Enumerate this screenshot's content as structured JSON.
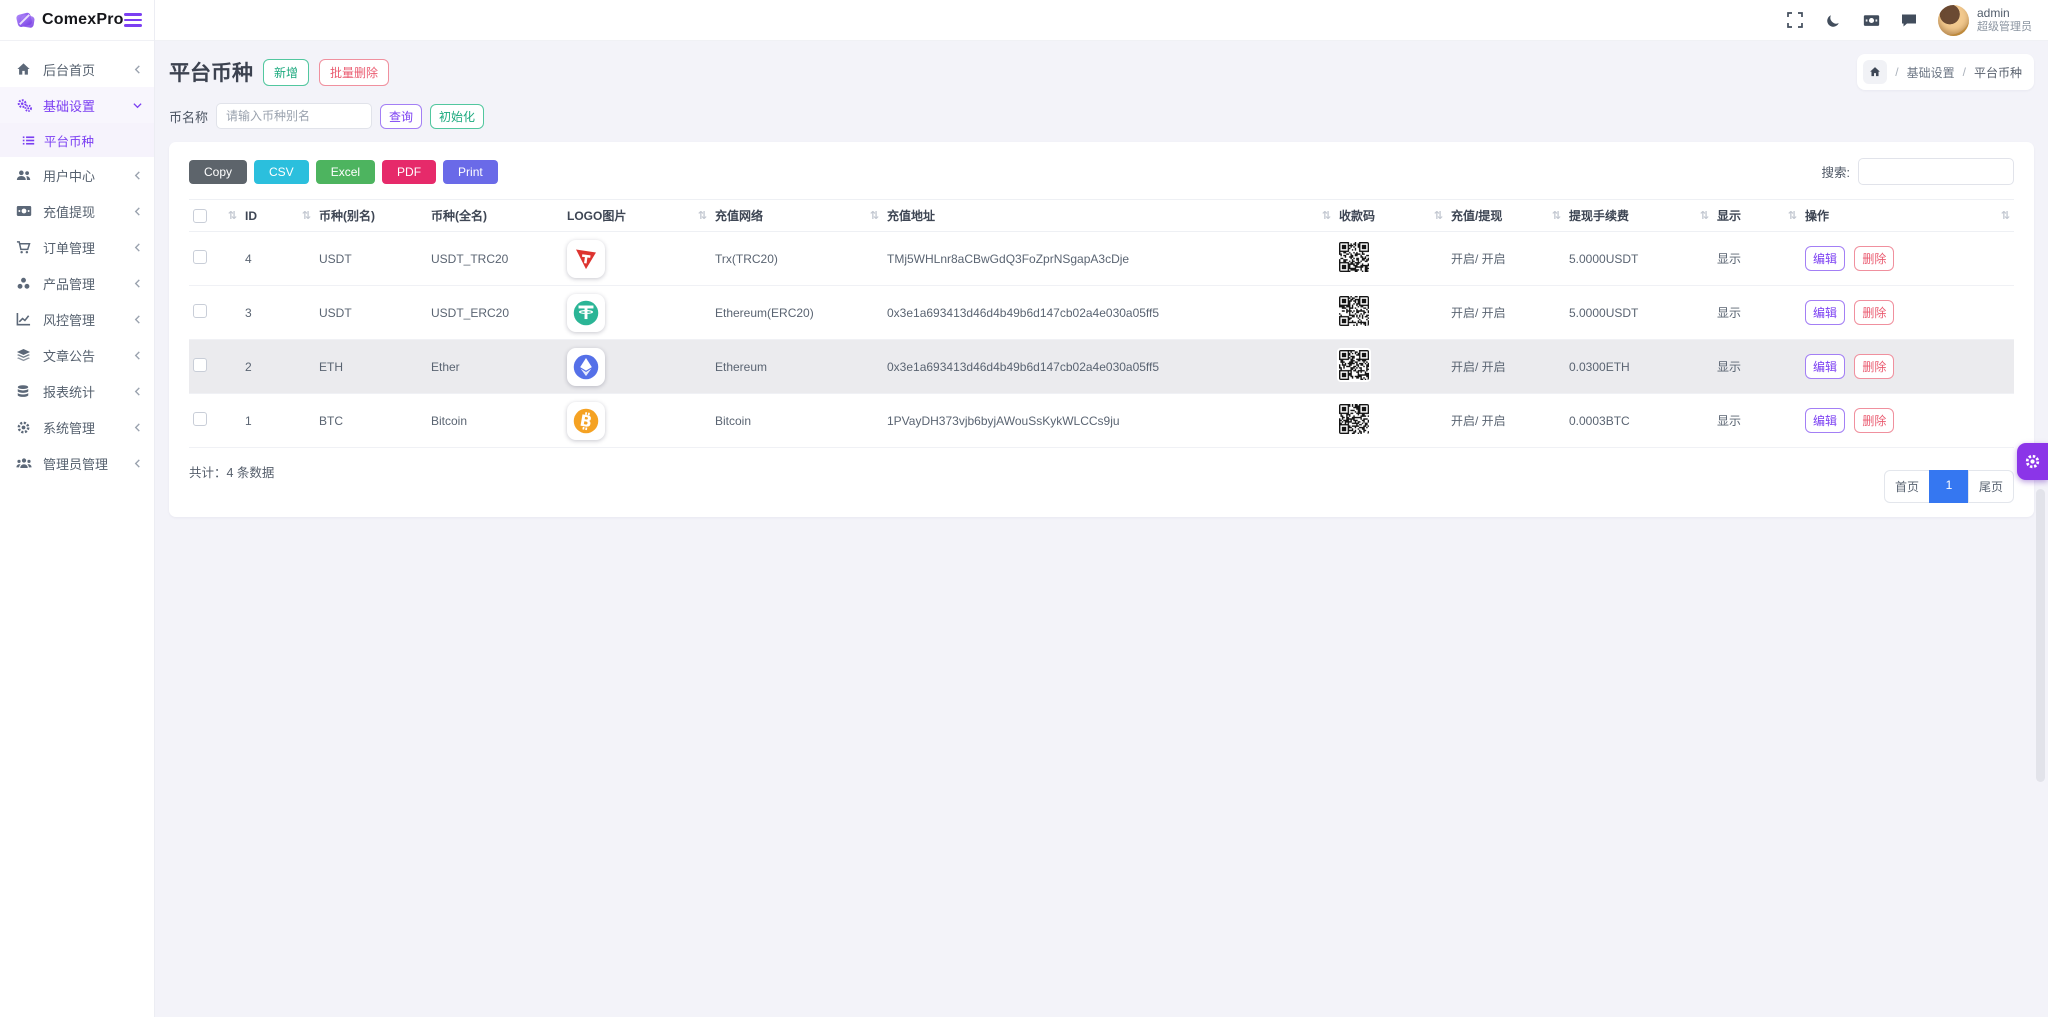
{
  "brand": {
    "name": "ComexPro"
  },
  "topbar": {
    "user_name": "admin",
    "user_role": "超级管理员"
  },
  "sidebar": {
    "items": [
      {
        "label": "后台首页"
      },
      {
        "label": "基础设置"
      },
      {
        "label": "平台币种"
      },
      {
        "label": "用户中心"
      },
      {
        "label": "充值提现"
      },
      {
        "label": "订单管理"
      },
      {
        "label": "产品管理"
      },
      {
        "label": "风控管理"
      },
      {
        "label": "文章公告"
      },
      {
        "label": "报表统计"
      },
      {
        "label": "系统管理"
      },
      {
        "label": "管理员管理"
      }
    ]
  },
  "page": {
    "title": "平台币种",
    "add_label": "新增",
    "batch_delete_label": "批量删除",
    "breadcrumb": {
      "items": [
        "基础设置",
        "平台币种"
      ],
      "separator": "/"
    },
    "filter": {
      "label": "币名称",
      "placeholder": "请输入币种别名",
      "query_label": "查询",
      "init_label": "初始化"
    }
  },
  "table": {
    "export_buttons": {
      "copy": "Copy",
      "csv": "CSV",
      "excel": "Excel",
      "pdf": "PDF",
      "print": "Print"
    },
    "search_label": "搜索:",
    "columns": {
      "id": "ID",
      "alias": "币种(别名)",
      "fullname": "币种(全名)",
      "logo": "LOGO图片",
      "network": "充值网络",
      "address": "充值地址",
      "qrcode": "收款码",
      "deposit_withdraw": "充值/提现",
      "fee": "提现手续费",
      "display": "显示",
      "actions": "操作"
    },
    "rows": [
      {
        "id": "4",
        "alias": "USDT",
        "fullname": "USDT_TRC20",
        "logo": "tron-logo",
        "network": "Trx(TRC20)",
        "address": "TMj5WHLnr8aCBwGdQ3FoZprNSgapA3cDje",
        "deposit_withdraw": "开启/ 开启",
        "fee": "5.0000USDT",
        "display": "显示"
      },
      {
        "id": "3",
        "alias": "USDT",
        "fullname": "USDT_ERC20",
        "logo": "tether-logo",
        "network": "Ethereum(ERC20)",
        "address": "0x3e1a693413d46d4b49b6d147cb02a4e030a05ff5",
        "deposit_withdraw": "开启/ 开启",
        "fee": "5.0000USDT",
        "display": "显示"
      },
      {
        "id": "2",
        "alias": "ETH",
        "fullname": "Ether",
        "logo": "ethereum-logo",
        "network": "Ethereum",
        "address": "0x3e1a693413d46d4b49b6d147cb02a4e030a05ff5",
        "deposit_withdraw": "开启/ 开启",
        "fee": "0.0300ETH",
        "display": "显示"
      },
      {
        "id": "1",
        "alias": "BTC",
        "fullname": "Bitcoin",
        "logo": "bitcoin-logo",
        "network": "Bitcoin",
        "address": "1PVayDH373vjb6byjAWouSsKykWLCCs9ju",
        "deposit_withdraw": "开启/ 开启",
        "fee": "0.0003BTC",
        "display": "显示"
      }
    ],
    "edit_label": "编辑",
    "delete_label": "删除",
    "total_text": "共计：4 条数据",
    "pagination": {
      "first": "首页",
      "page": "1",
      "last": "尾页"
    }
  },
  "colors": {
    "accent_purple": "#7b3ff2",
    "success_green": "#1ba97e",
    "danger_red": "#ea5b70",
    "csv_cyan": "#2bbfdd",
    "excel_green": "#4db45f",
    "pdf_pink": "#e62a6a",
    "print_indigo": "#6a6ae8",
    "copy_gray": "#5d646b",
    "pagination_active_blue": "#3577f1",
    "tron_red": "#dd3430",
    "tether_teal": "#2bb596",
    "ethereum_blue": "#5570e8",
    "bitcoin_orange": "#f5a223"
  }
}
